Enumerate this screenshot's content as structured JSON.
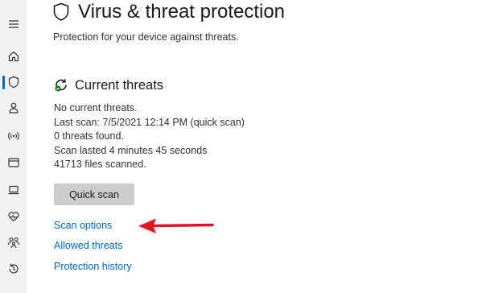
{
  "sidebar": {
    "items": [
      {
        "icon": "hamburger-menu-icon"
      },
      {
        "icon": "home-icon"
      },
      {
        "icon": "shield-icon",
        "active": true
      },
      {
        "icon": "person-icon"
      },
      {
        "icon": "wireless-icon"
      },
      {
        "icon": "app-browser-icon"
      },
      {
        "icon": "laptop-icon"
      },
      {
        "icon": "heart-pulse-icon"
      },
      {
        "icon": "family-icon"
      },
      {
        "icon": "history-icon"
      }
    ],
    "accent_color": "#0067c0"
  },
  "page": {
    "title": "Virus & threat protection",
    "subtitle": "Protection for your device against threats."
  },
  "current_threats": {
    "title": "Current threats",
    "lines": [
      "No current threats.",
      "Last scan: 7/5/2021 12:14 PM (quick scan)",
      "0 threats found.",
      "Scan lasted 4 minutes 45 seconds",
      "41713 files scanned."
    ],
    "quick_scan_label": "Quick scan"
  },
  "links": {
    "scan_options": "Scan options",
    "allowed_threats": "Allowed threats",
    "protection_history": "Protection history"
  },
  "annotation": {
    "arrow_color": "#e81123"
  }
}
